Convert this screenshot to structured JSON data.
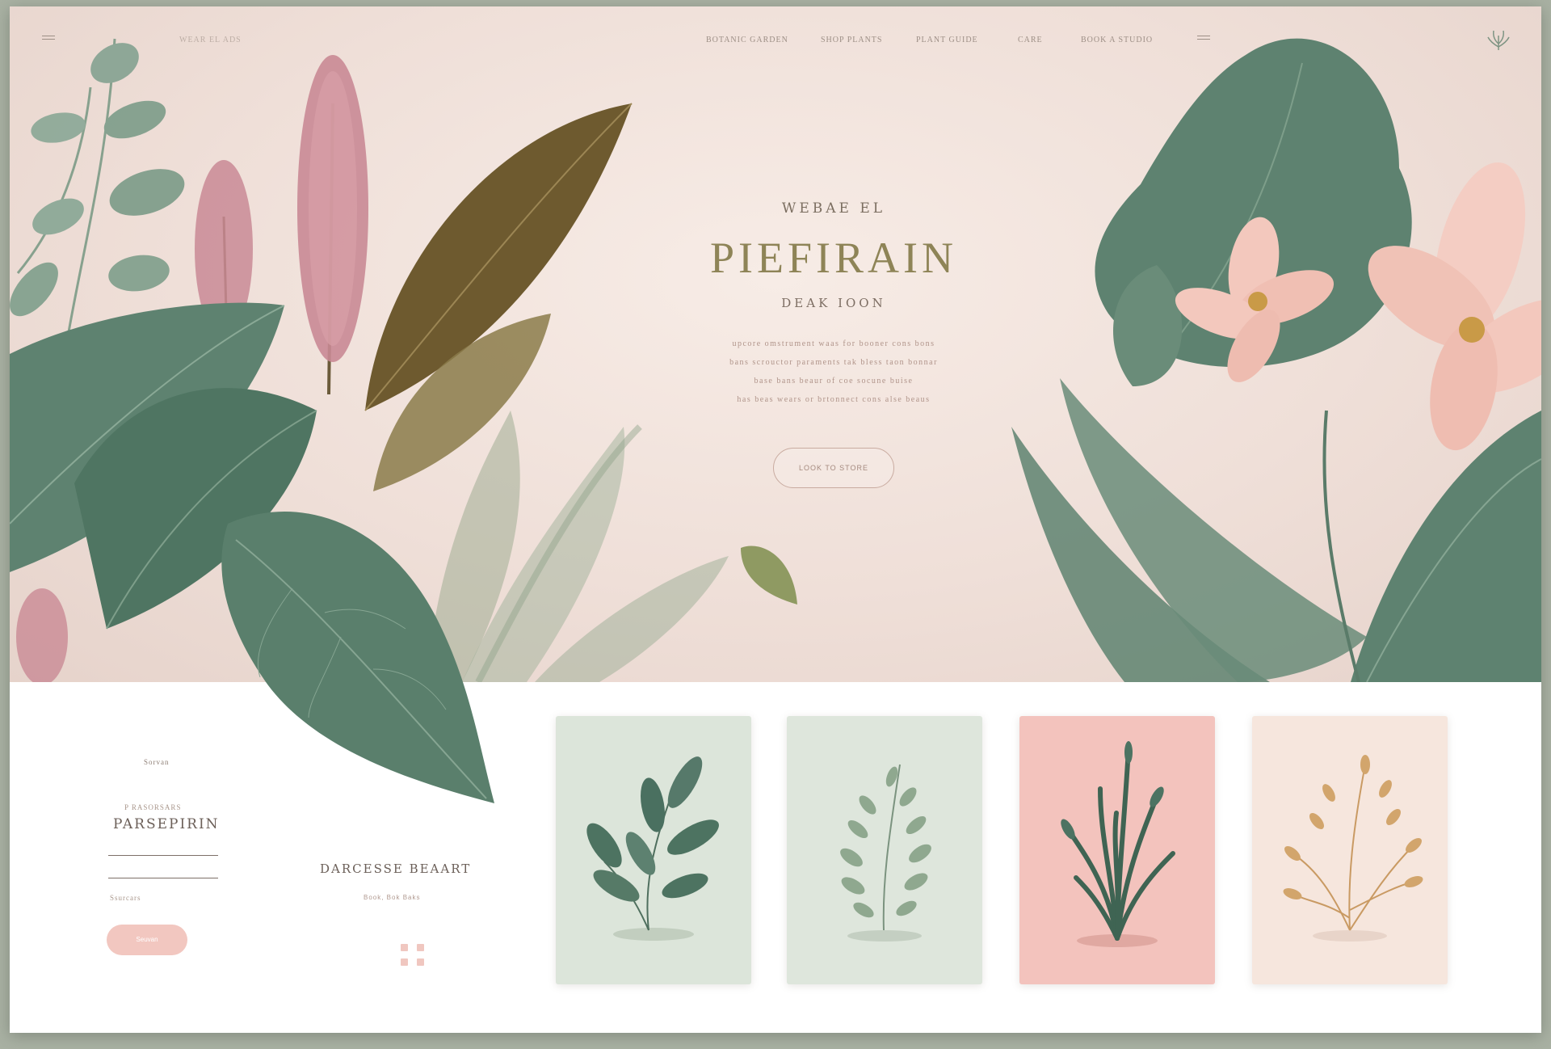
{
  "nav": {
    "brand": "WEAR EL ADS",
    "links": [
      "BOTANIC GARDEN",
      "SHOP PLANTS",
      "PLANT GUIDE",
      "CARE",
      "BOOK A STUDIO"
    ]
  },
  "hero": {
    "eyebrow": "WEBAE EL",
    "headline": "PIEFIRAIN",
    "subhead": "DEAK IOON",
    "body": [
      "upcore omstrument waas for booner cons bons",
      "bans scrouctor paraments tak bless taon bonnar",
      "base bans beaur of coe socune buise",
      "has beas wears or brtonnect cons alse beaus"
    ],
    "cta": "Look to store"
  },
  "lower": {
    "section_label": "Sorvan",
    "field_hint": "P RASORSARS",
    "field_title": "PARSEPIRIN",
    "field_caption": "Ssurcars",
    "pink_button": "Seuvan",
    "feature_title": "DARCESSE BEAART",
    "feature_sub": "Book, Bok Baks"
  },
  "cards": [
    {
      "name": "Eucalyptus sprig",
      "bg": "#dce5da"
    },
    {
      "name": "Olive fern",
      "bg": "#dee6dc"
    },
    {
      "name": "Grass tuft",
      "bg": "#f3c3bd"
    },
    {
      "name": "Golden sprig",
      "bg": "#f6e6dd"
    }
  ],
  "colors": {
    "sage": "#5e8270",
    "blush": "#f2c7c0",
    "olive": "#6e5a2f",
    "cream": "#f7ece6"
  }
}
